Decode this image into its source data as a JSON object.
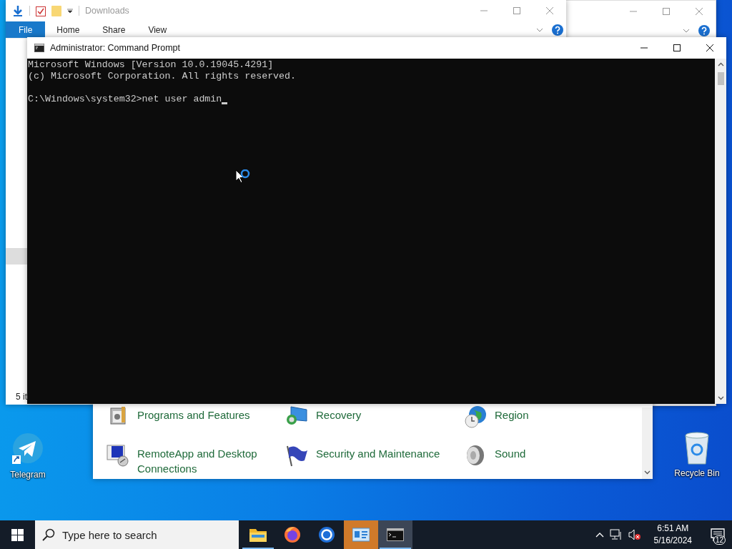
{
  "explorer": {
    "title": "Downloads",
    "ribbon_tabs": [
      {
        "label": "File",
        "selected": true
      },
      {
        "label": "Home",
        "selected": false
      },
      {
        "label": "Share",
        "selected": false
      },
      {
        "label": "View",
        "selected": false
      }
    ],
    "status": "5 it"
  },
  "console": {
    "title": "Administrator: Command Prompt",
    "output": [
      "Microsoft Windows [Version 10.0.19045.4291]",
      "(c) Microsoft Corporation. All rights reserved."
    ],
    "prompt": "C:\\Windows\\system32>net user admin"
  },
  "control_panel": {
    "items": [
      {
        "label": "Programs and Features",
        "kind": "programs"
      },
      {
        "label": "Recovery",
        "kind": "recovery"
      },
      {
        "label": "Region",
        "kind": "region"
      },
      {
        "label": "RemoteApp and Desktop Connections",
        "kind": "remoteapp"
      },
      {
        "label": "Security and Maintenance",
        "kind": "security"
      },
      {
        "label": "Sound",
        "kind": "sound"
      }
    ]
  },
  "desktop_icons": [
    {
      "label": "Telegram",
      "kind": "telegram"
    },
    {
      "label": "Recycle Bin",
      "kind": "recycle-bin"
    }
  ],
  "taskbar": {
    "search": {
      "placeholder": "Type here to search"
    },
    "apps": [
      {
        "kind": "folder",
        "open": true,
        "selected": false,
        "flashing": false
      },
      {
        "kind": "firefox",
        "open": false,
        "selected": false,
        "flashing": false
      },
      {
        "kind": "browser",
        "open": false,
        "selected": false,
        "flashing": false
      },
      {
        "kind": "control-panel",
        "open": false,
        "selected": false,
        "flashing": true
      },
      {
        "kind": "terminal",
        "open": true,
        "selected": true,
        "flashing": false
      }
    ],
    "time": "6:51 AM",
    "date": "5/16/2024",
    "notification_count": "12"
  }
}
